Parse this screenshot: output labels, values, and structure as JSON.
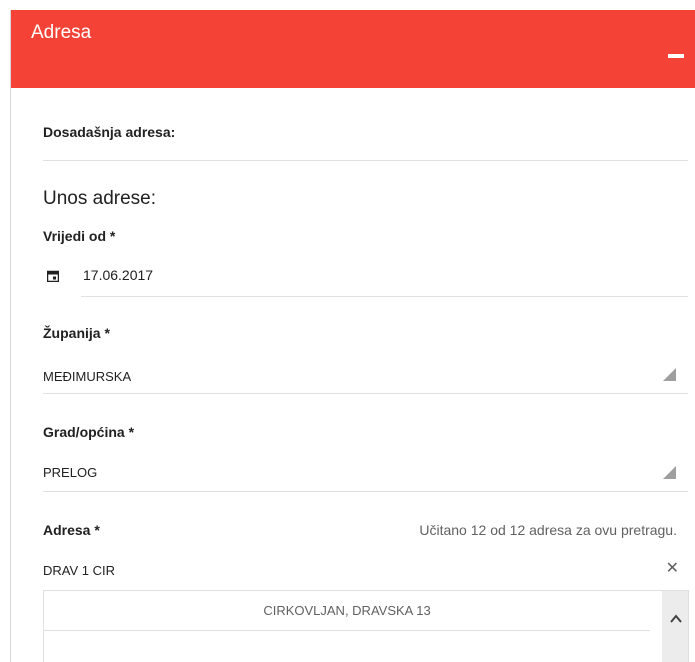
{
  "header": {
    "title": "Adresa",
    "collapse_icon": "minus-icon"
  },
  "current_address": {
    "label": "Dosadašnja adresa:"
  },
  "entry": {
    "section_title": "Unos adrese:",
    "valid_from": {
      "label": "Vrijedi od *",
      "value": "17.06.2017",
      "icon": "calendar-icon"
    },
    "county": {
      "label": "Županija *",
      "value": "MEĐIMURSKA"
    },
    "city": {
      "label": "Grad/općina *",
      "value": "PRELOG"
    },
    "address": {
      "label": "Adresa *",
      "hint": "Učitano 12 od 12 adresa za ovu pretragu.",
      "search_value": "DRAV 1 CIR",
      "clear_icon": "close-icon",
      "results": [
        "CIRKOVLJAN, DRAVSKA 13"
      ]
    }
  }
}
